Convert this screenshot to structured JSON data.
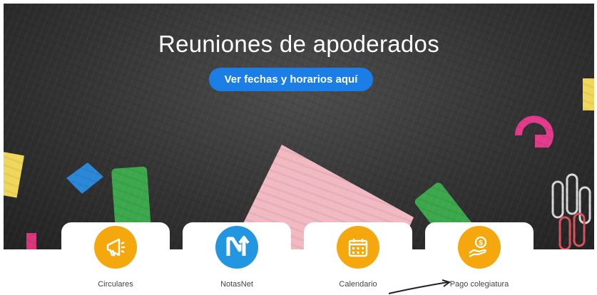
{
  "hero": {
    "title": "Reuniones de apoderados",
    "button_label": "Ver fechas y horarios aquí"
  },
  "quick_links": [
    {
      "label": "Circulares",
      "icon": "megaphone-icon",
      "color": "#f5a80e"
    },
    {
      "label": "NotasNet",
      "icon": "notasnet-logo-icon",
      "color": "#2296e0"
    },
    {
      "label": "Calendario",
      "icon": "calendar-icon",
      "color": "#f5a80e"
    },
    {
      "label": "Pago colegiatura",
      "icon": "hand-coin-icon",
      "color": "#f5a80e"
    }
  ],
  "colors": {
    "button": "#1a7ee6",
    "accent_orange": "#f5a80e",
    "accent_blue": "#2296e0"
  }
}
